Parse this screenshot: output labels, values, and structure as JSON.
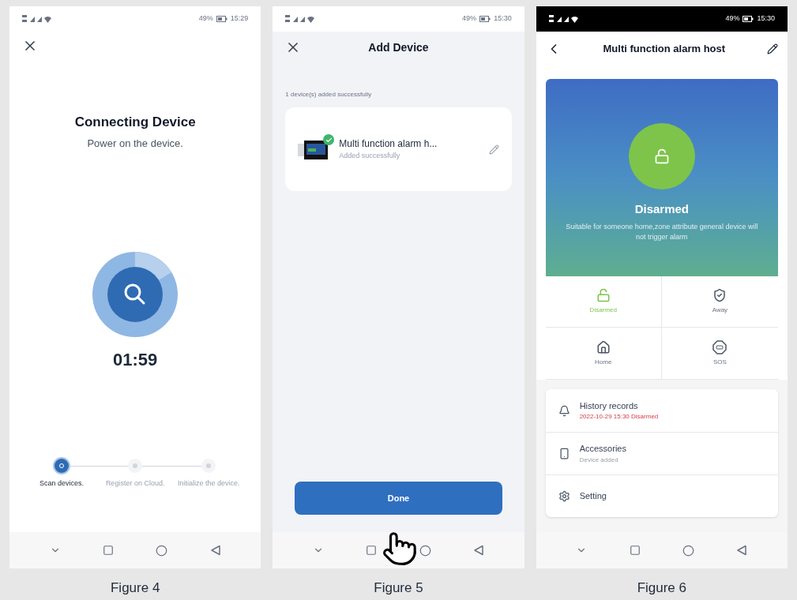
{
  "figures": [
    {
      "kind": "connecting",
      "caption": "Figure 4",
      "status_bar": {
        "dark": false,
        "battery": "49%",
        "time": "15:29"
      },
      "title": "Connecting Device",
      "subtitle": "Power on the device.",
      "timer": "01:59",
      "steps": [
        {
          "label": "Scan devices.",
          "selected": true
        },
        {
          "label": "Register on Cloud.",
          "selected": false
        },
        {
          "label": "Initialize the device.",
          "selected": false
        }
      ]
    },
    {
      "kind": "add_device",
      "caption": "Figure 5",
      "status_bar": {
        "dark": false,
        "battery": "49%",
        "time": "15:30"
      },
      "title": "Add Device",
      "summary": "1 device(s) added successfully",
      "device": {
        "name": "Multi function alarm h...",
        "status": "Added successfully"
      },
      "button": "Done"
    },
    {
      "kind": "device_panel",
      "caption": "Figure 6",
      "status_bar": {
        "dark": true,
        "battery": "49%",
        "time": "15:30"
      },
      "title": "Multi function alarm host",
      "state_title": "Disarmed",
      "description": "Suitable for someone home,zone attribute general device will not trigger alarm",
      "modes": [
        {
          "kind": "disarmed",
          "label": "Disarmed",
          "selected": true
        },
        {
          "kind": "away",
          "label": "Away",
          "selected": false
        },
        {
          "kind": "home",
          "label": "Home",
          "selected": false
        },
        {
          "kind": "sos",
          "label": "SOS",
          "selected": false
        }
      ],
      "menu": [
        {
          "kind": "history",
          "title": "History records",
          "subtitle": "2022-10-29 15:30 Disarmed"
        },
        {
          "kind": "accessories",
          "title": "Accessories",
          "subtitle": "Device added"
        },
        {
          "kind": "setting",
          "title": "Setting"
        }
      ]
    }
  ]
}
